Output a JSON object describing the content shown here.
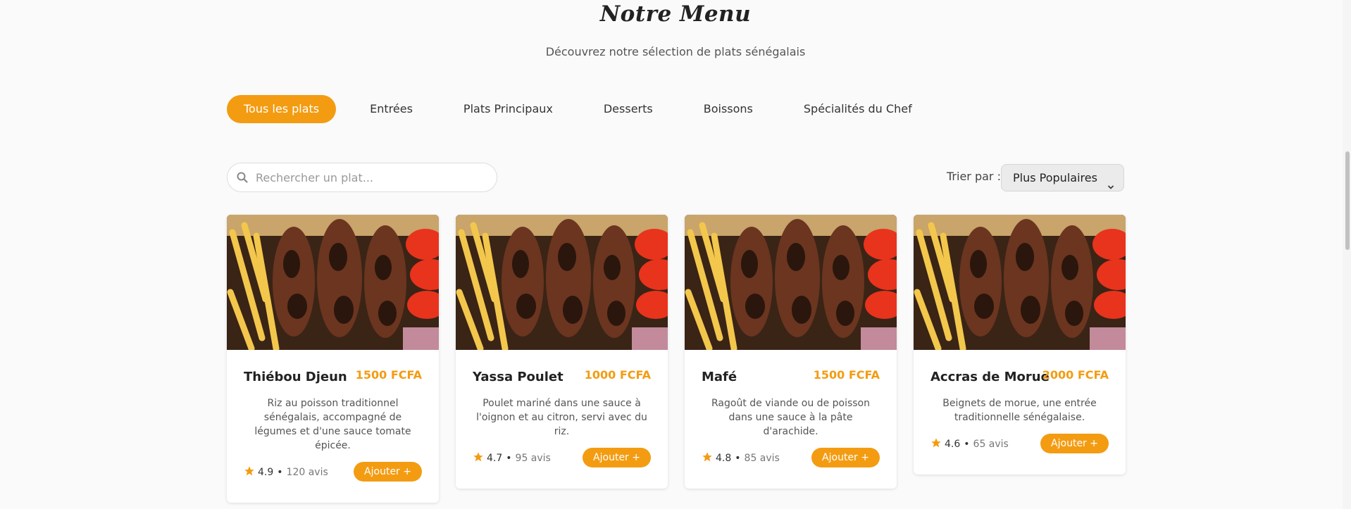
{
  "header": {
    "title": "Notre Menu",
    "subtitle": "Découvrez notre sélection de plats sénégalais"
  },
  "tabs": [
    {
      "label": "Tous les plats",
      "active": true
    },
    {
      "label": "Entrées",
      "active": false
    },
    {
      "label": "Plats Principaux",
      "active": false
    },
    {
      "label": "Desserts",
      "active": false
    },
    {
      "label": "Boissons",
      "active": false
    },
    {
      "label": "Spécialités du Chef",
      "active": false
    }
  ],
  "search": {
    "placeholder": "Rechercher un plat...",
    "value": "",
    "icon": "search-icon"
  },
  "sort": {
    "label": "Trier par :",
    "selected": "Plus Populaires"
  },
  "dishes": [
    {
      "name": "Thiébou Djeun",
      "price": "1500 FCFA",
      "description": "Riz au poisson traditionnel sénégalais, accompagné de légumes et d'une sauce tomate épicée.",
      "rating": "4.9",
      "reviews": "120 avis",
      "button": "Ajouter +"
    },
    {
      "name": "Yassa Poulet",
      "price": "1000 FCFA",
      "description": "Poulet mariné dans une sauce à l'oignon et au citron, servi avec du riz.",
      "rating": "4.7",
      "reviews": "95 avis",
      "button": "Ajouter +"
    },
    {
      "name": "Mafé",
      "price": "1500 FCFA",
      "description": "Ragoût de viande ou de poisson dans une sauce à la pâte d'arachide.",
      "rating": "4.8",
      "reviews": "85 avis",
      "button": "Ajouter +"
    },
    {
      "name": "Accras de Morue",
      "price": "2000 FCFA",
      "description": "Beignets de morue, une entrée traditionnelle sénégalaise.",
      "rating": "4.6",
      "reviews": "65 avis",
      "button": "Ajouter +"
    }
  ],
  "colors": {
    "accent": "#f39c12",
    "background": "#fafafa",
    "card": "#ffffff"
  }
}
